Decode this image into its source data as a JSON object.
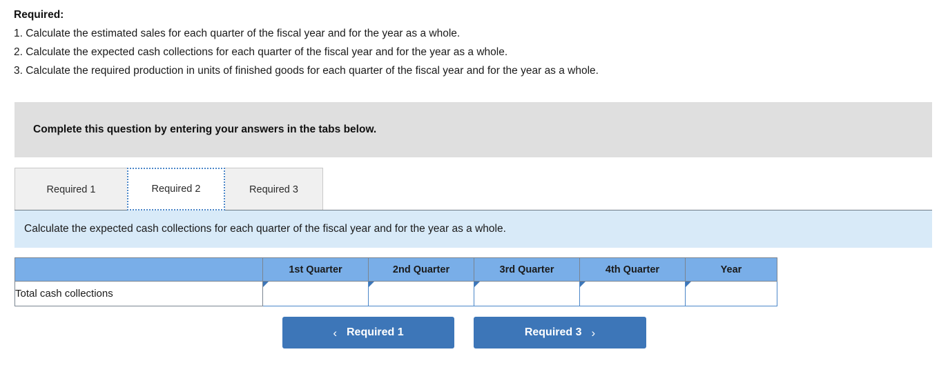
{
  "required": {
    "heading": "Required:",
    "items": [
      "1. Calculate the estimated sales for each quarter of the fiscal year and for the year as a whole.",
      "2. Calculate the expected cash collections for each quarter of the fiscal year and for the year as a whole.",
      "3. Calculate the required production in units of finished goods for each quarter of the fiscal year and for the year as a whole."
    ]
  },
  "complete_banner": {
    "text": "Complete this question by entering your answers in the tabs below."
  },
  "tabs": [
    {
      "label": "Required 1",
      "active": false
    },
    {
      "label": "Required 2",
      "active": true
    },
    {
      "label": "Required 3",
      "active": false
    }
  ],
  "instruction": {
    "text": "Calculate the expected cash collections for each quarter of the fiscal year and for the year as a whole."
  },
  "table": {
    "headers": [
      "",
      "1st Quarter",
      "2nd Quarter",
      "3rd Quarter",
      "4th Quarter",
      "Year"
    ],
    "rows": [
      {
        "label": "Total cash collections",
        "values": [
          "",
          "",
          "",
          "",
          ""
        ]
      }
    ]
  },
  "nav": {
    "prev_label": "Required 1",
    "prev_icon": "chevron-left-icon",
    "prev_glyph": "‹",
    "next_label": "Required 3",
    "next_icon": "chevron-right-icon",
    "next_glyph": "›"
  },
  "colors": {
    "header_blue": "#79aee8",
    "button_blue": "#3d76b8",
    "banner_gray": "#dfdfdf",
    "instruction_blue": "#d8eaf8",
    "focus_blue": "#4a86c8"
  }
}
